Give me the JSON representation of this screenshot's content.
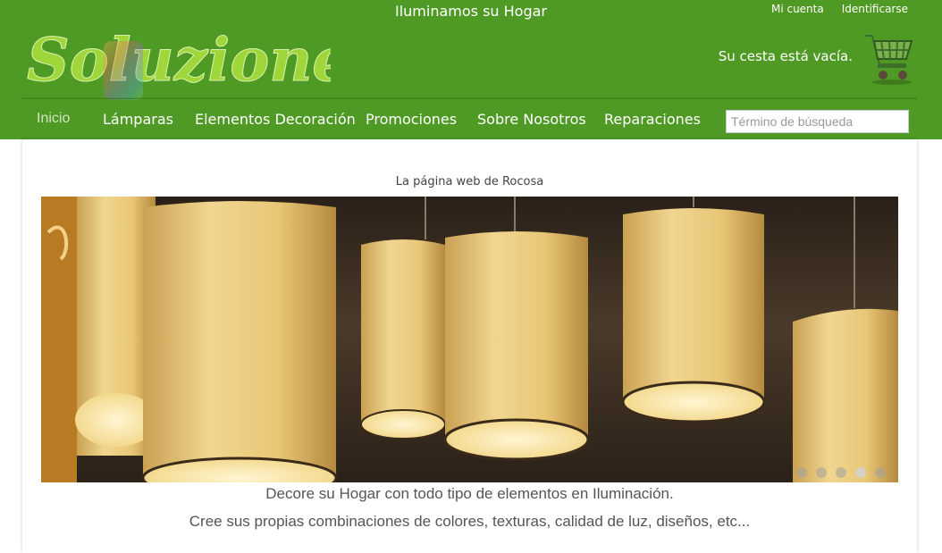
{
  "header": {
    "tagline": "Iluminamos su Hogar",
    "account_links": [
      "Mi cuenta",
      "Identificarse"
    ],
    "logo_text": "Soluziones",
    "cart_status": "Su cesta está vacía."
  },
  "nav": {
    "items": [
      "Inicio",
      "Lámparas",
      "Elementos Decoración",
      "Promociones",
      "Sobre Nosotros",
      "Reparaciones"
    ],
    "active": "Inicio",
    "search_placeholder": "Término de búsqueda"
  },
  "main": {
    "subtitle": "La página web de Rocosa",
    "slider": {
      "slide_count": 5,
      "active_slide": 4
    },
    "lines": [
      "Decore su Hogar con todo tipo de elementos en Iluminación.",
      "Cree sus propias combinaciones de colores, texturas, calidad de luz, diseños, etc..."
    ]
  },
  "colors": {
    "brand_green": "#4f9a24",
    "logo_green": "#9fd63a",
    "lamp_glow": "#f3d98e"
  },
  "icons": [
    "shopping-cart-icon"
  ]
}
